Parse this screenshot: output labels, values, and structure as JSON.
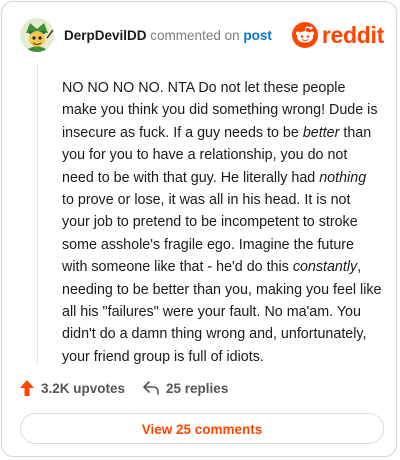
{
  "comment": {
    "author": "DerpDevilDD",
    "commented_on_text": "commented on",
    "post_link_label": "post",
    "body": {
      "p1": "NO NO NO NO. NTA Do not let these people make you think you did something wrong! Dude is insecure as fuck. If a guy needs to be ",
      "em1": "better",
      "p2": " than you for you to have a relationship, you do not need to be with that guy. He literally had ",
      "em2": "nothing",
      "p3": " to prove or lose, it was all in his head. It is not your job to pretend to be incompetent to stroke some asshole's fragile ego. Imagine the future with someone like that - he'd do this ",
      "em3": "constantly",
      "p4": ", needing to be better than you, making you feel like all his \"failures\" were your fault. No ma'am. You didn't do a damn thing wrong and, unfortunately, your friend group is full of idiots."
    },
    "upvotes_label": "3.2K upvotes",
    "replies_label": "25 replies",
    "view_button_label": "View 25 comments"
  },
  "brand": {
    "name": "reddit",
    "color": "#ff4500"
  },
  "colors": {
    "link": "#0079d3",
    "text": "#1a1a1b",
    "muted": "#7c7c7c"
  },
  "icons": {
    "upvote": "upvote-arrow-icon",
    "reply": "reply-arrow-icon",
    "logo": "reddit-snoo-icon"
  }
}
